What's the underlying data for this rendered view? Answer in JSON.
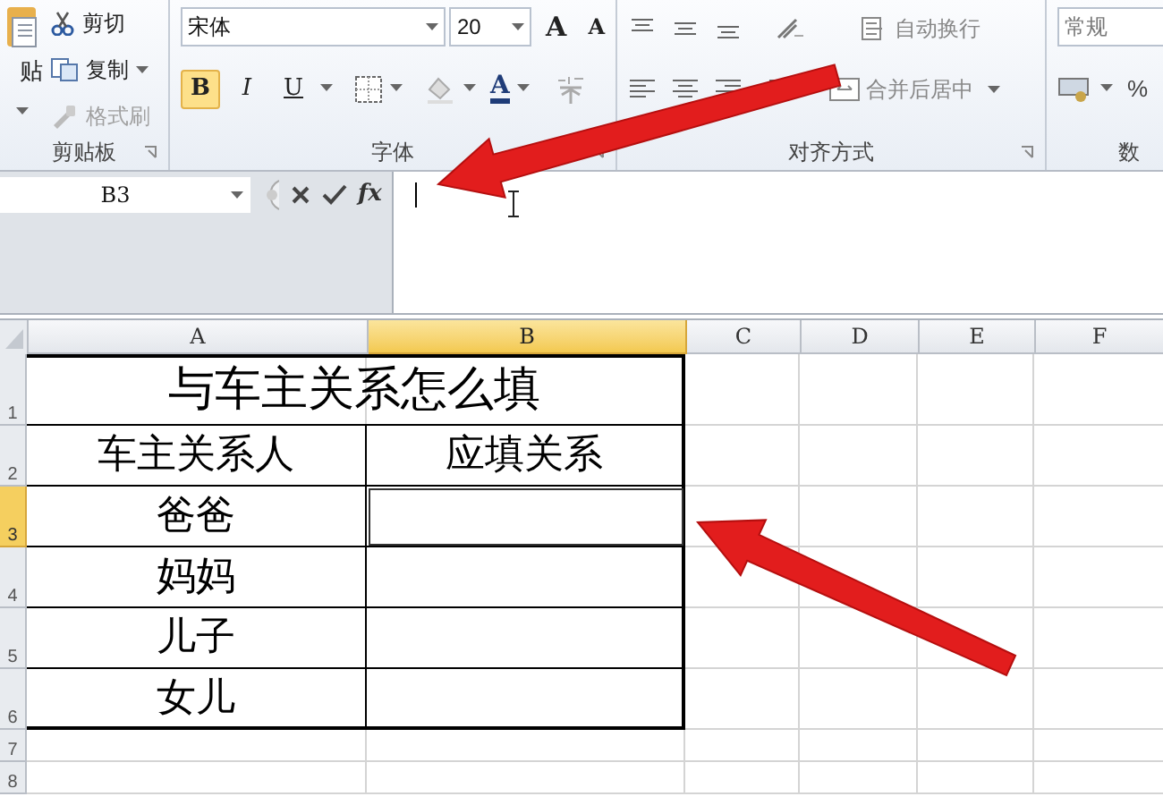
{
  "ribbon": {
    "groups": [
      {
        "kind": "clipboard",
        "label": "剪贴板",
        "paste": "贴",
        "items": [
          {
            "label": "剪切",
            "disabled": false
          },
          {
            "label": "复制",
            "disabled": false
          },
          {
            "label": "格式刷",
            "disabled": true
          }
        ]
      },
      {
        "kind": "font",
        "label": "字体",
        "font_name": "宋体",
        "font_size": "20",
        "grow": "A",
        "shrink": "A",
        "styles": [
          {
            "label": "B",
            "selected": true
          },
          {
            "label": "I",
            "selected": false
          },
          {
            "label": "U",
            "selected": false
          }
        ],
        "font_color": "A"
      },
      {
        "kind": "alignment",
        "label": "对齐方式",
        "wrap": "自动换行",
        "merge": "合并后居中"
      },
      {
        "kind": "number",
        "label": "数",
        "format": "常规",
        "percent": "%"
      }
    ]
  },
  "formula_bar": {
    "name_box": "B3",
    "function": "fx"
  },
  "sheet": {
    "columns": [
      {
        "label": "A",
        "selected": false
      },
      {
        "label": "B",
        "selected": true
      },
      {
        "label": "C",
        "selected": false
      },
      {
        "label": "D",
        "selected": false
      },
      {
        "label": "E",
        "selected": false
      },
      {
        "label": "F",
        "selected": false
      }
    ],
    "rows": [
      {
        "number": "1",
        "selected": false,
        "kind": "title",
        "cells": [
          "与车主关系怎么填"
        ]
      },
      {
        "number": "2",
        "selected": false,
        "kind": "pair",
        "cells": [
          "车主关系人",
          "应填关系"
        ]
      },
      {
        "number": "3",
        "selected": true,
        "kind": "pair",
        "cells": [
          "爸爸"
        ]
      },
      {
        "number": "4",
        "selected": false,
        "kind": "pair",
        "cells": [
          "妈妈"
        ]
      },
      {
        "number": "5",
        "selected": false,
        "kind": "pair",
        "cells": [
          "儿子"
        ]
      },
      {
        "number": "6",
        "selected": false,
        "kind": "pair",
        "cells": [
          "女儿"
        ]
      },
      {
        "number": "7",
        "selected": false,
        "kind": "blank"
      },
      {
        "number": "8",
        "selected": false,
        "kind": "blank"
      }
    ]
  }
}
